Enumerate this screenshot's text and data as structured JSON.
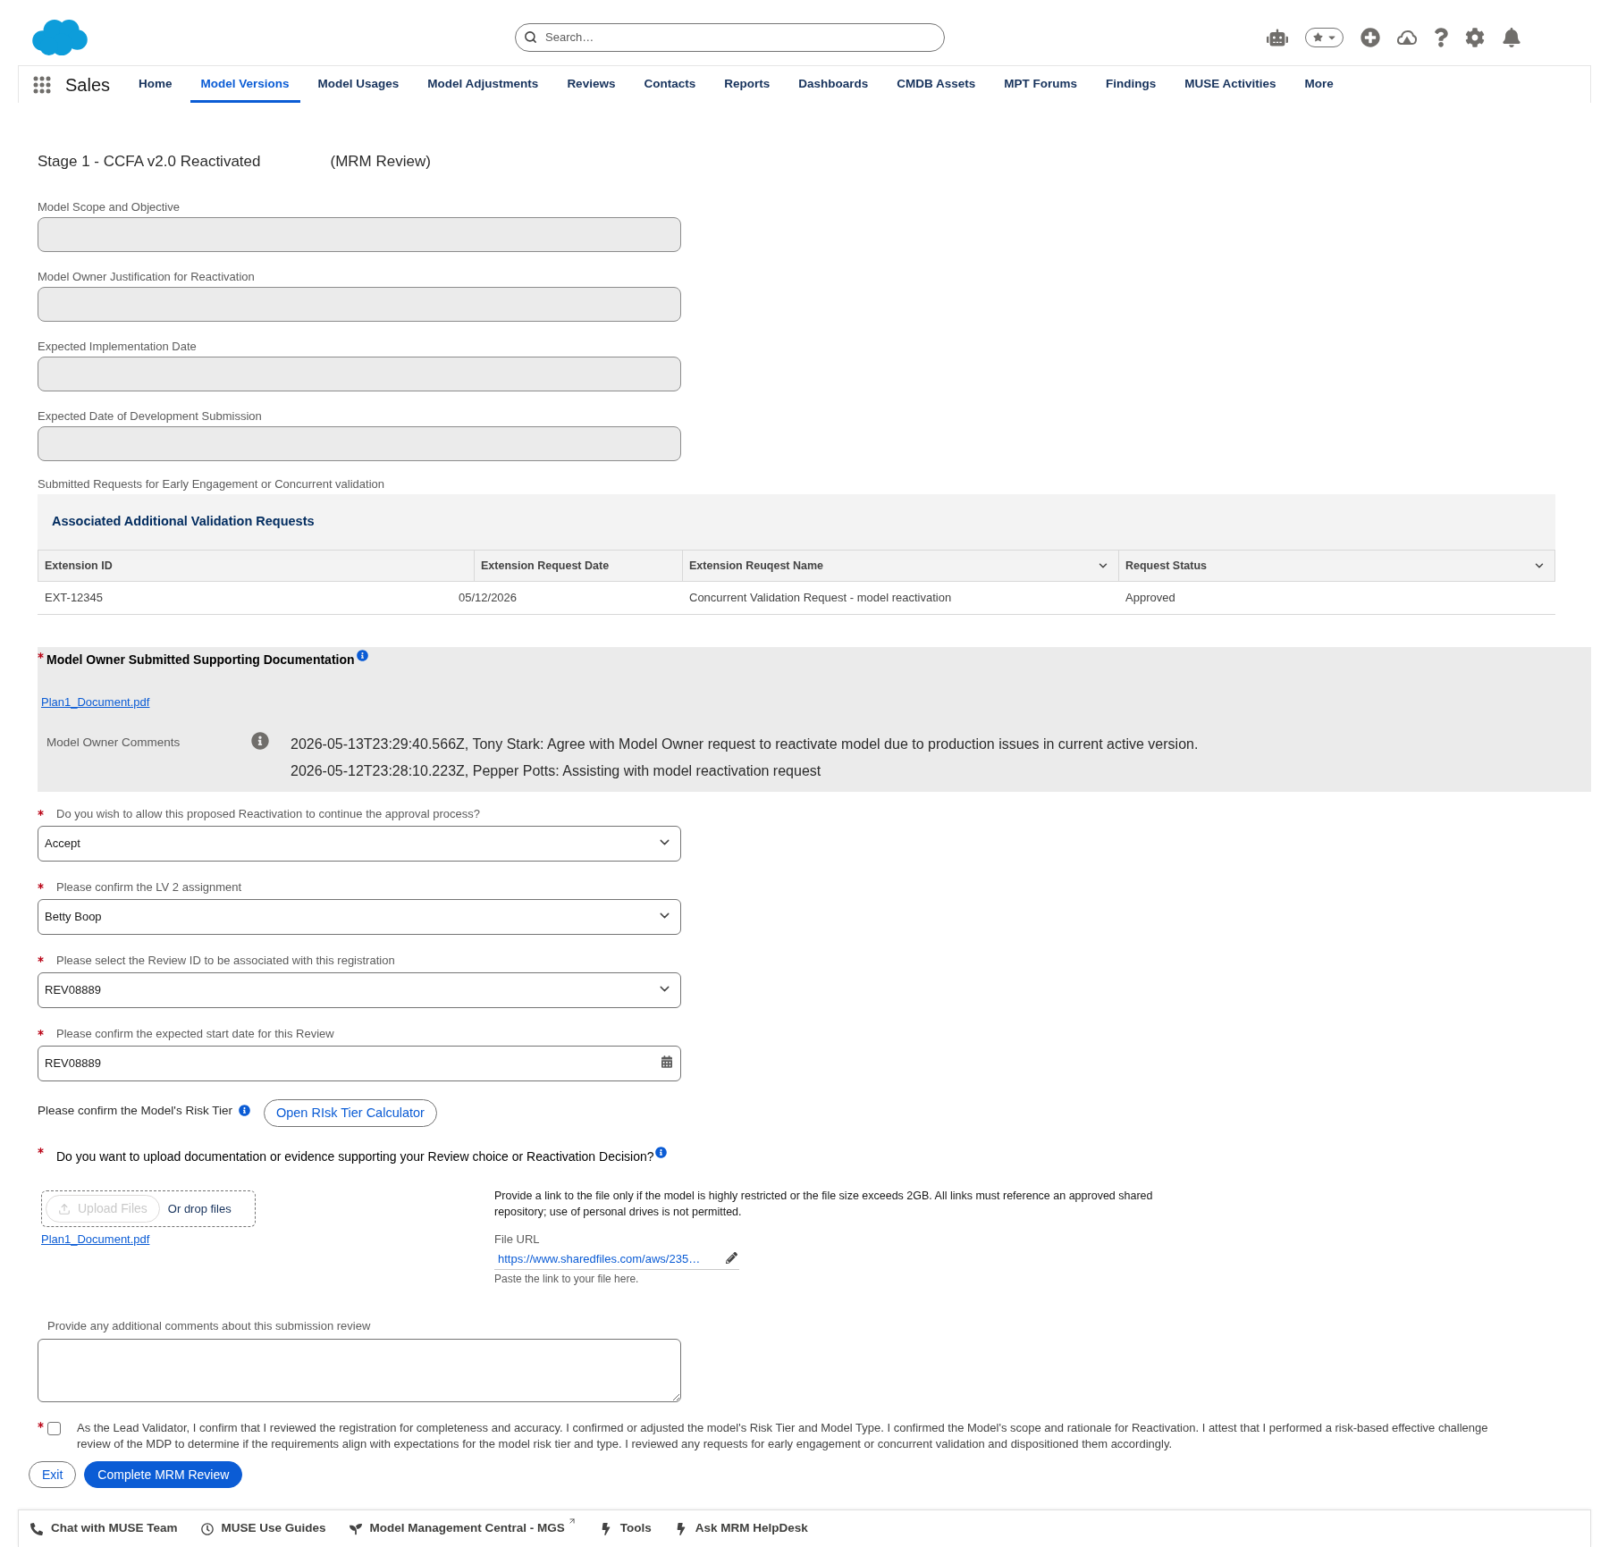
{
  "header": {
    "search": {
      "placeholder": "Search…"
    }
  },
  "nav": {
    "app_name": "Sales",
    "tabs": [
      {
        "label": "Home",
        "selected": false
      },
      {
        "label": "Model Versions",
        "selected": true
      },
      {
        "label": "Model Usages",
        "selected": false
      },
      {
        "label": "Model Adjustments",
        "selected": false
      },
      {
        "label": "Reviews",
        "selected": false
      },
      {
        "label": "Contacts",
        "selected": false
      },
      {
        "label": "Reports",
        "selected": false
      },
      {
        "label": "Dashboards",
        "selected": false
      },
      {
        "label": "CMDB Assets",
        "selected": false
      },
      {
        "label": "MPT Forums",
        "selected": false
      },
      {
        "label": "Findings",
        "selected": false
      },
      {
        "label": "MUSE Activities",
        "selected": false
      },
      {
        "label": "More",
        "selected": false
      }
    ]
  },
  "page": {
    "title": "Stage 1 - CCFA v2.0 Reactivated",
    "subtitle": "(MRM Review)"
  },
  "readonly_fields": [
    {
      "label": "Model Scope and Objective",
      "disabled": true
    },
    {
      "label": "Model Owner Justification for Reactivation",
      "disabled": true
    },
    {
      "label": "Expected Implementation Date",
      "disabled": true
    },
    {
      "label": "Expected Date of Development Submission",
      "disabled": true
    }
  ],
  "requests": {
    "label": "Submitted Requests for Early Engagement or Concurrent validation",
    "table": {
      "title": "Associated Additional Validation Requests",
      "columns": [
        {
          "label": "Extension ID",
          "menu": false
        },
        {
          "label": "Extension Request Date",
          "menu": false
        },
        {
          "label": "Extension Reuqest Name",
          "menu": true
        },
        {
          "label": "Request Status",
          "menu": true
        }
      ],
      "rows": [
        [
          "EXT-12345",
          "05/12/2026",
          "Concurrent Validation Request - model reactivation",
          "Approved"
        ]
      ]
    }
  },
  "supporting_docs": {
    "required": true,
    "title": "Model Owner Submitted Supporting Documentation",
    "file": "Plan1_Document.pdf",
    "comments_label": "Model Owner Comments",
    "comments": [
      "2026-05-13T23:29:40.566Z, Tony Stark: Agree with Model Owner request to reactivate model due to production issues in current active version.",
      "2026-05-12T23:28:10.223Z, Pepper Potts: Assisting with model reactivation request"
    ]
  },
  "questions": [
    {
      "kind": "select",
      "required": true,
      "label": "Do you wish to allow this proposed Reactivation to continue the approval process?",
      "value": "Accept"
    },
    {
      "kind": "select",
      "required": true,
      "label": "Please confirm the LV 2 assignment",
      "value": "Betty Boop"
    },
    {
      "kind": "select",
      "required": true,
      "label": "Please select the Review ID to be associated with this registration",
      "value": "REV08889"
    },
    {
      "kind": "date",
      "required": true,
      "label": "Please confirm the expected start date for this Review",
      "value": "REV08889"
    }
  ],
  "risk_tier": {
    "label": "Please confirm the Model's Risk Tier",
    "button": "Open RIsk Tier Calculator"
  },
  "upload": {
    "required": true,
    "question": "Do you want to upload documentation or evidence supporting your Review choice or Reactivation Decision?",
    "upload_button": {
      "label": "Upload Files",
      "disabled": true
    },
    "drop_label": "Or drop files",
    "file": "Plan1_Document.pdf",
    "link_note": "Provide a link to the file only if the model is highly restricted or the file size exceeds 2GB. All links must reference an approved shared repository; use of personal drives is not permitted.",
    "url_field": {
      "label": "File URL",
      "value": "https://www.sharedfiles.com/aws/235…",
      "hint": "Paste the link to your file here."
    }
  },
  "additional_comments": {
    "label": "Provide any additional comments about this submission review"
  },
  "attestation": {
    "required": true,
    "checked": false,
    "text": "As the Lead Validator, I confirm that I reviewed the registration for completeness and accuracy. I confirmed or adjusted the model's Risk Tier and Model Type. I confirmed the Model's scope and rationale for Reactivation. I attest that I performed a risk-based effective challenge review of the MDP to determine if the requirements align with expectations for the model risk tier and type. I reviewed any requests for early engagement or concurrent validation and dispositioned them accordingly."
  },
  "actions": [
    {
      "kind": "outline",
      "label": "Exit"
    },
    {
      "kind": "primary",
      "label": "Complete MRM Review"
    }
  ],
  "footer": {
    "items": [
      {
        "kind": "phone",
        "label": "Chat with MUSE Team",
        "external": false
      },
      {
        "kind": "clock",
        "label": "MUSE Use Guides",
        "external": false
      },
      {
        "kind": "seedling",
        "label": "Model Management Central - MGS",
        "external": true
      },
      {
        "kind": "bolt",
        "label": "Tools",
        "external": false
      },
      {
        "kind": "bolt",
        "label": "Ask MRM HelpDesk",
        "external": false
      }
    ]
  }
}
